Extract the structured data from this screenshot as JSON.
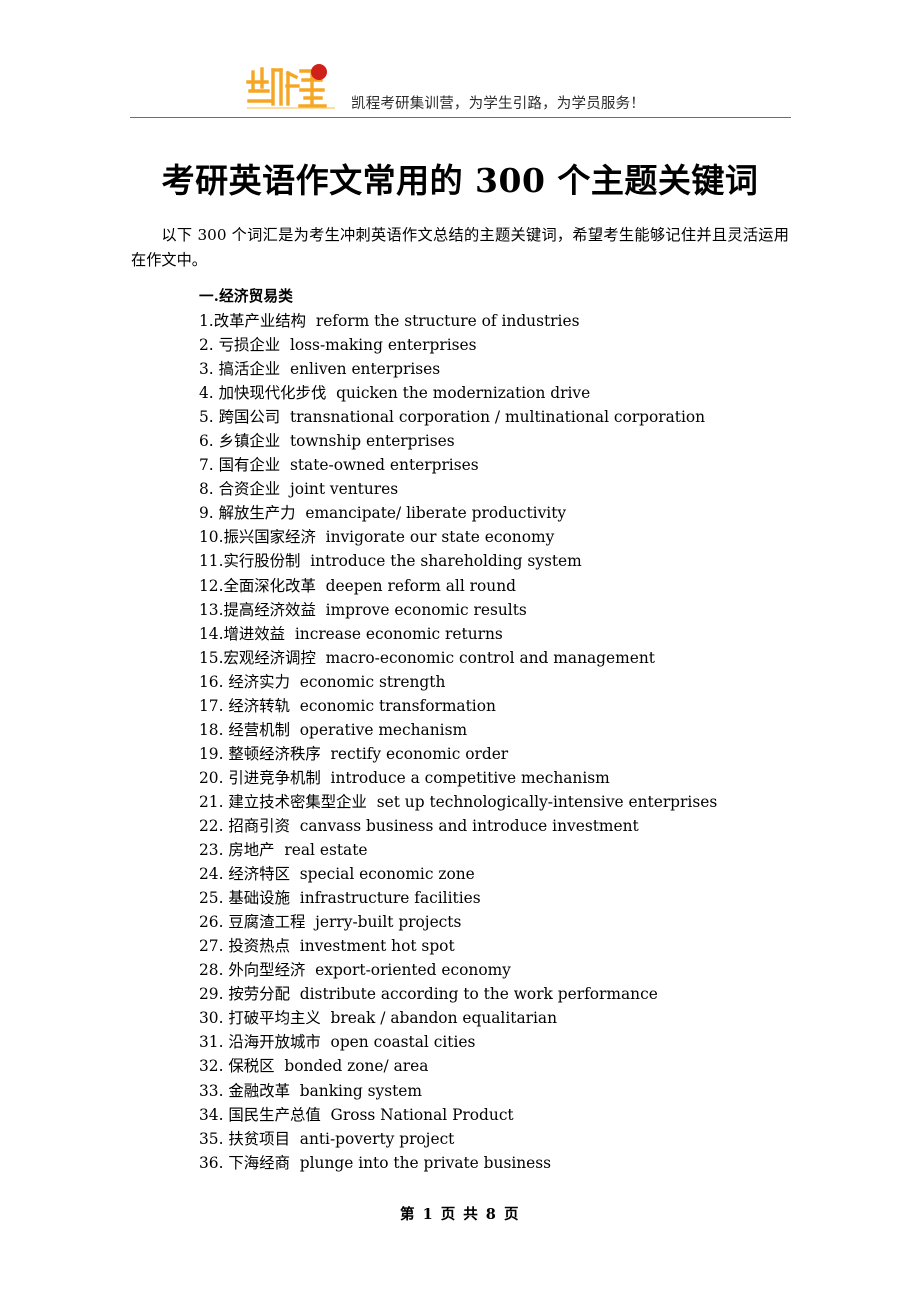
{
  "header": {
    "logo_alt": "凯程",
    "tagline": "凯程考研集训营，为学生引路，为学员服务！",
    "logo_colors": {
      "primary": "#F5A623",
      "light": "#FBCB6B",
      "dot": "#D0201A"
    }
  },
  "title": "考研英语作文常用的 300 个主题关键词",
  "intro": "以下 300 个词汇是为考生冲刺英语作文总结的主题关键词，希望考生能够记住并且灵活运用在作文中。",
  "section": {
    "header": "一.经济贸易类",
    "entries": [
      {
        "num": "1.",
        "cn": "改革产业结构",
        "en": "reform the structure of industries"
      },
      {
        "num": "2.",
        "cn": "亏损企业",
        "en": "loss-making enterprises"
      },
      {
        "num": "3.",
        "cn": "搞活企业",
        "en": "enliven enterprises"
      },
      {
        "num": "4.",
        "cn": "加快现代化步伐",
        "en": "quicken the modernization drive"
      },
      {
        "num": "5.",
        "cn": "跨国公司",
        "en": "transnational corporation / multinational corporation"
      },
      {
        "num": "6.",
        "cn": "乡镇企业",
        "en": "township enterprises"
      },
      {
        "num": "7.",
        "cn": "国有企业",
        "en": "state-owned enterprises"
      },
      {
        "num": "8.",
        "cn": "合资企业",
        "en": "joint ventures"
      },
      {
        "num": "9.",
        "cn": "解放生产力",
        "en": "emancipate/ liberate productivity"
      },
      {
        "num": "10.",
        "cn": "振兴国家经济",
        "en": "invigorate our state economy"
      },
      {
        "num": "11.",
        "cn": "实行股份制",
        "en": "introduce the shareholding system"
      },
      {
        "num": "12.",
        "cn": "全面深化改革",
        "en": "deepen reform all round"
      },
      {
        "num": "13.",
        "cn": "提高经济效益",
        "en": "improve economic results"
      },
      {
        "num": "14.",
        "cn": "增进效益",
        "en": "increase economic returns"
      },
      {
        "num": "15.",
        "cn": "宏观经济调控",
        "en": "macro-economic control and management"
      },
      {
        "num": "16.",
        "cn": "经济实力",
        "en": "economic strength"
      },
      {
        "num": "17.",
        "cn": "经济转轨",
        "en": "economic transformation"
      },
      {
        "num": "18.",
        "cn": "经营机制",
        "en": "operative mechanism"
      },
      {
        "num": "19.",
        "cn": "整顿经济秩序",
        "en": "rectify economic order"
      },
      {
        "num": "20.",
        "cn": "引进竞争机制",
        "en": "introduce a competitive mechanism"
      },
      {
        "num": "21.",
        "cn": "建立技术密集型企业",
        "en": "set up technologically-intensive enterprises"
      },
      {
        "num": "22.",
        "cn": "招商引资",
        "en": "canvass business and introduce investment"
      },
      {
        "num": "23.",
        "cn": "房地产",
        "en": "real estate"
      },
      {
        "num": "24.",
        "cn": "经济特区",
        "en": "special economic zone"
      },
      {
        "num": "25.",
        "cn": "基础设施",
        "en": "infrastructure facilities"
      },
      {
        "num": "26.",
        "cn": "豆腐渣工程",
        "en": "jerry-built projects"
      },
      {
        "num": "27.",
        "cn": "投资热点",
        "en": "investment hot spot"
      },
      {
        "num": "28.",
        "cn": "外向型经济",
        "en": "export-oriented economy"
      },
      {
        "num": "29.",
        "cn": "按劳分配",
        "en": "distribute according to the work performance"
      },
      {
        "num": "30.",
        "cn": "打破平均主义",
        "en": "break / abandon equalitarian"
      },
      {
        "num": "31.",
        "cn": "沿海开放城市",
        "en": "open coastal cities"
      },
      {
        "num": "32.",
        "cn": "保税区",
        "en": "bonded zone/ area"
      },
      {
        "num": "33.",
        "cn": "金融改革",
        "en": "banking system"
      },
      {
        "num": "34.",
        "cn": "国民生产总值",
        "en": "Gross National Product"
      },
      {
        "num": "35.",
        "cn": "扶贫项目",
        "en": "anti-poverty project"
      },
      {
        "num": "36.",
        "cn": "下海经商",
        "en": "plunge into the private business"
      }
    ],
    "no_space_after_num": [
      "1.",
      "10.",
      "11.",
      "12.",
      "13.",
      "14.",
      "15."
    ]
  },
  "footer": "第 1 页 共 8 页"
}
